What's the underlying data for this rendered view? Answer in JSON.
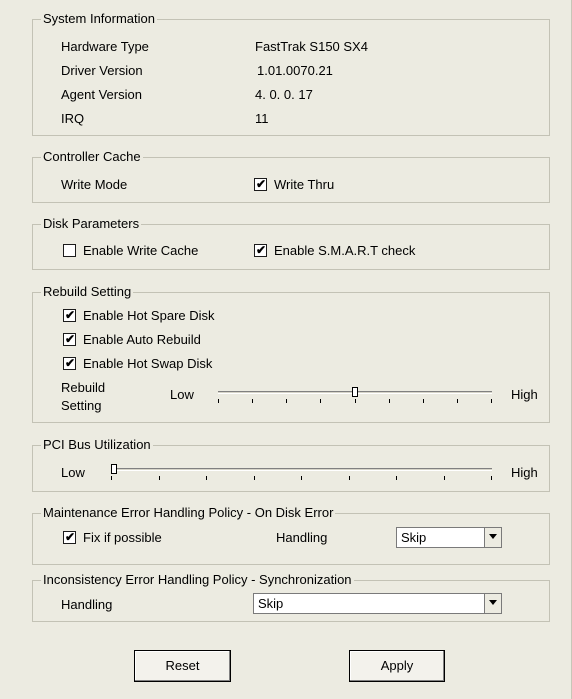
{
  "system_info": {
    "legend": "System Information",
    "rows": [
      {
        "label": "Hardware Type",
        "value": "FastTrak S150 SX4"
      },
      {
        "label": "Driver Version",
        "value": "1.01.0070.21"
      },
      {
        "label": "Agent Version",
        "value": "4. 0. 0. 17"
      },
      {
        "label": "IRQ",
        "value": "11"
      }
    ]
  },
  "controller_cache": {
    "legend": "Controller Cache",
    "write_mode_label": "Write Mode",
    "write_thru_label": "Write Thru",
    "write_thru_checked": true
  },
  "disk_parameters": {
    "legend": "Disk Parameters",
    "write_cache_label": "Enable Write Cache",
    "write_cache_checked": false,
    "smart_label": "Enable S.M.A.R.T check",
    "smart_checked": true
  },
  "rebuild": {
    "legend": "Rebuild Setting",
    "hot_spare_label": "Enable Hot Spare Disk",
    "hot_spare_checked": true,
    "auto_rebuild_label": "Enable Auto Rebuild",
    "auto_rebuild_checked": true,
    "hot_swap_label": "Enable Hot Swap Disk",
    "hot_swap_checked": true,
    "slider_label_line1": "Rebuild",
    "slider_label_line2": "Setting",
    "low_label": "Low",
    "high_label": "High",
    "slider_level": 0.5
  },
  "pci": {
    "legend": "PCI Bus Utilization",
    "low_label": "Low",
    "high_label": "High",
    "slider_level": 0.0
  },
  "maintenance": {
    "legend": "Maintenance Error Handling Policy - On Disk Error",
    "fix_label": "Fix if possible",
    "fix_checked": true,
    "handling_label": "Handling",
    "handling_value": "Skip"
  },
  "inconsistency": {
    "legend": "Inconsistency Error Handling Policy - Synchronization",
    "handling_label": "Handling",
    "handling_value": "Skip"
  },
  "buttons": {
    "reset": "Reset",
    "apply": "Apply"
  }
}
